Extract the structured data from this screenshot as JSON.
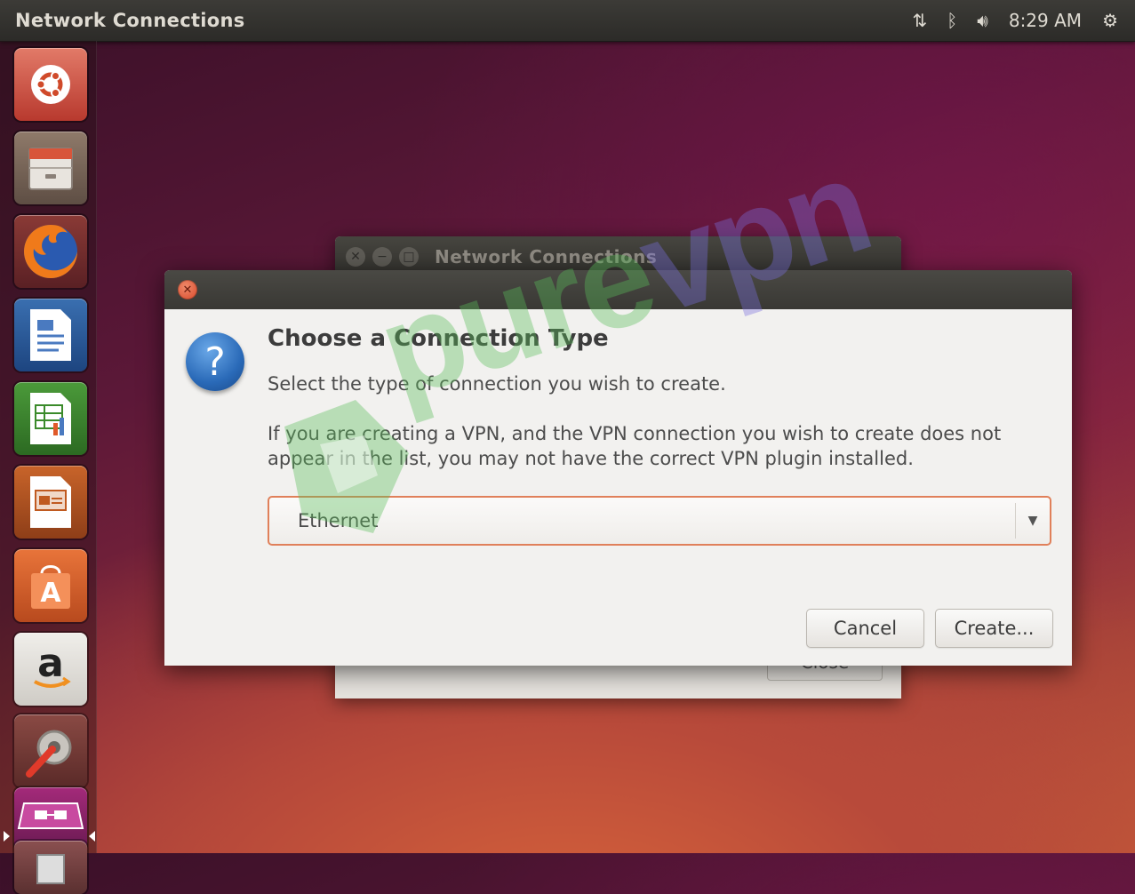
{
  "top_panel": {
    "title": "Network Connections",
    "clock": "8:29 AM",
    "icons": [
      "network-icon",
      "bluetooth-icon",
      "volume-icon",
      "session-gear-icon"
    ]
  },
  "launcher": {
    "items": [
      "ubuntu-dash",
      "files",
      "firefox",
      "libreoffice-writer",
      "libreoffice-calc",
      "libreoffice-impress",
      "ubuntu-software-center",
      "amazon",
      "system-settings",
      "network-connections",
      "trash"
    ]
  },
  "background_window": {
    "title": "Network Connections",
    "close_label": "Close"
  },
  "dialog": {
    "heading": "Choose a Connection Type",
    "subtitle": "Select the type of connection you wish to create.",
    "body": "If you are creating a VPN, and the VPN connection you wish to create does not appear in the list, you may not have the correct VPN plugin installed.",
    "combo_value": "Ethernet",
    "cancel_label": "Cancel",
    "create_label": "Create..."
  },
  "watermark": {
    "text_pure": "pure",
    "text_vpn": "vpn"
  },
  "colors": {
    "accent_orange": "#e0805a",
    "panel_dark": "#3c3b37",
    "close_red": "#d8482a",
    "question_blue": "#2a6ab8"
  }
}
